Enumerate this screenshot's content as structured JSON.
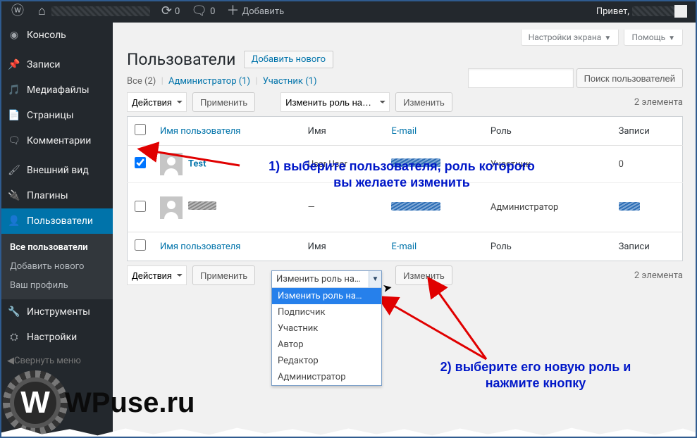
{
  "adminbar": {
    "comments_count": "0",
    "updates_count": "0",
    "new_label": "Добавить",
    "howdy_prefix": "Привет,"
  },
  "sidebar": {
    "items": [
      {
        "label": "Консоль",
        "icon": "dashboard"
      },
      {
        "label": "Записи",
        "icon": "pin"
      },
      {
        "label": "Медиафайлы",
        "icon": "media"
      },
      {
        "label": "Страницы",
        "icon": "page"
      },
      {
        "label": "Комментарии",
        "icon": "comment"
      },
      {
        "label": "Внешний вид",
        "icon": "brush"
      },
      {
        "label": "Плагины",
        "icon": "plugin"
      },
      {
        "label": "Пользователи",
        "icon": "user",
        "current": true
      },
      {
        "label": "Инструменты",
        "icon": "tools"
      },
      {
        "label": "Настройки",
        "icon": "settings"
      }
    ],
    "submenu": [
      {
        "label": "Все пользователи",
        "current": true
      },
      {
        "label": "Добавить нового"
      },
      {
        "label": "Ваш профиль"
      }
    ],
    "collapse_label": "Свернуть меню"
  },
  "screen_meta": {
    "options_label": "Настройки экрана",
    "help_label": "Помощь"
  },
  "page": {
    "title": "Пользователи",
    "add_new": "Добавить нового"
  },
  "filters": {
    "all_label": "Все",
    "all_count": "(2)",
    "admin_label": "Администратор",
    "admin_count": "(1)",
    "contrib_label": "Участник",
    "contrib_count": "(1)"
  },
  "search": {
    "button": "Поиск пользователей"
  },
  "bulk": {
    "actions_label": "Действия",
    "apply_label": "Применить",
    "change_role_label": "Изменить роль на…",
    "change_btn": "Изменить",
    "items_count": "2 элемента"
  },
  "columns": {
    "username": "Имя пользователя",
    "name": "Имя",
    "email": "E-mail",
    "role": "Роль",
    "posts": "Записи"
  },
  "rows": [
    {
      "checked": true,
      "username": "Test",
      "name": "User User",
      "role": "Участник",
      "posts": "0"
    },
    {
      "checked": false,
      "username": "",
      "name": "—",
      "role": "Администратор",
      "posts": ""
    }
  ],
  "role_dropdown": {
    "selected": "Изменить роль на…",
    "options": [
      "Изменить роль на…",
      "Подписчик",
      "Участник",
      "Автор",
      "Редактор",
      "Администратор"
    ]
  },
  "annotations": {
    "step1": "1) выберите пользователя, роль которого\nвы желаете изменить",
    "step2": "2) выберите его новую роль и\nнажмите кнопку"
  },
  "watermark": "WPuse.ru"
}
